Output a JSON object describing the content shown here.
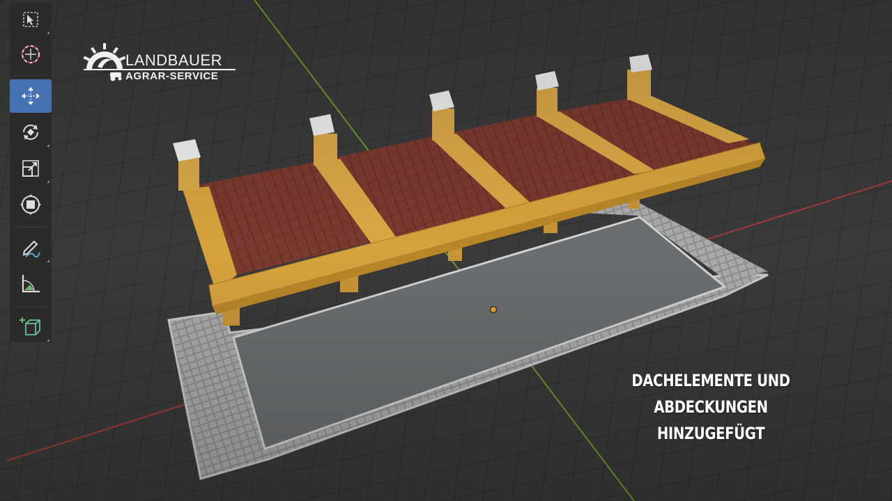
{
  "logo": {
    "name": "LANDBAUER",
    "sub": "AGRAR-SERVICE"
  },
  "caption": {
    "line1": "DACHELEMENTE UND ABDECKUNGEN",
    "line2": "HINZUGEFÜGT"
  },
  "toolbar": {
    "tools": [
      {
        "name": "select-box",
        "icon": "select-box-icon"
      },
      {
        "name": "cursor",
        "icon": "cursor-icon"
      },
      {
        "name": "move",
        "icon": "move-icon",
        "active": true
      },
      {
        "name": "rotate",
        "icon": "rotate-icon"
      },
      {
        "name": "scale",
        "icon": "scale-icon"
      },
      {
        "name": "transform",
        "icon": "transform-icon"
      },
      {
        "name": "annotate",
        "icon": "annotate-icon"
      },
      {
        "name": "measure",
        "icon": "measure-icon"
      },
      {
        "name": "add-cube",
        "icon": "add-cube-icon"
      }
    ]
  },
  "colors": {
    "viewport_bg": "#3a3a3a",
    "grid": "#2e2e2e",
    "toolbar_bg": "#2b2b2b",
    "active_tool": "#4772b3",
    "axis_x": "#a33a3a",
    "axis_y": "#6f9a2a",
    "wood": "#d6a23c",
    "roof": "#7a3a30",
    "asphalt": "#6b6e70",
    "paving": "#9a9c9e",
    "origin": "#f0a030"
  }
}
